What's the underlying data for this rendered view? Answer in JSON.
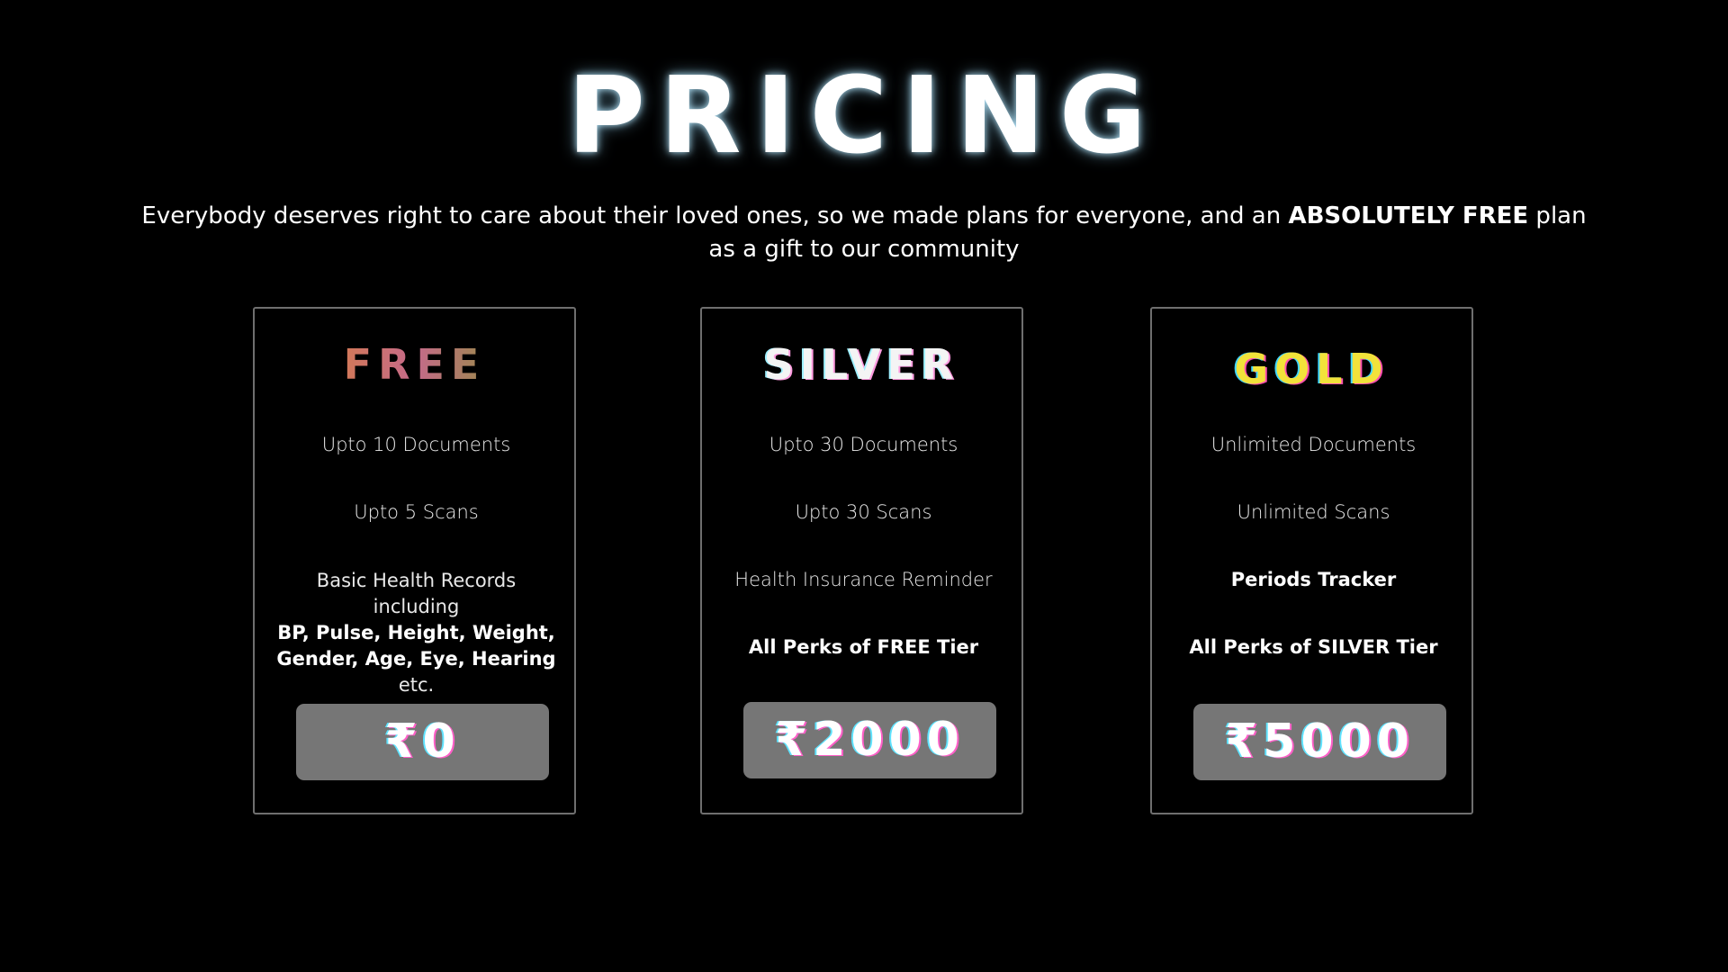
{
  "header": {
    "title": "PRICING",
    "subtitle_before": "Everybody deserves right to care about their loved ones, so we made plans for everyone, and an ",
    "subtitle_emphasis": "ABSOLUTELY FREE",
    "subtitle_after": " plan as a gift to our community"
  },
  "plans": [
    {
      "name": "FREE",
      "features": [
        "Upto 10 Documents",
        "Upto 5 Scans"
      ],
      "records_intro": "Basic Health Records including",
      "records_bold": "BP, Pulse, Height, Weight, Gender, Age, Eye, Hearing",
      "records_tail": "etc.",
      "price": "₹0"
    },
    {
      "name": "SILVER",
      "features": [
        "Upto 30 Documents",
        "Upto 30 Scans",
        "Health Insurance Reminder",
        "All Perks of FREE Tier"
      ],
      "price": "₹2000"
    },
    {
      "name": "GOLD",
      "features": [
        "Unlimited Documents",
        "Unlimited Scans",
        "Periods Tracker",
        "All Perks of SILVER Tier"
      ],
      "price": "₹5000"
    }
  ],
  "colors": {
    "background": "#000000",
    "card_border": "#6f6f6f",
    "price_button": "#767676",
    "gold_text": "#f2e23a",
    "glow_cyan": "#5fe3ff",
    "glow_magenta": "#ff5fc8"
  }
}
